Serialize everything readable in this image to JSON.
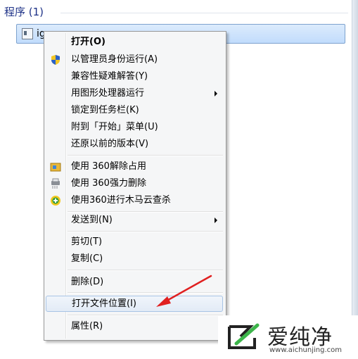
{
  "results": {
    "section_title": "程序 (1)",
    "selected_item_label": "ig"
  },
  "menu": {
    "items": [
      {
        "label": "打开(O)",
        "bold": true
      },
      {
        "label": "以管理员身份运行(A)",
        "icon": "uac-shield-icon"
      },
      {
        "label": "兼容性疑难解答(Y)"
      },
      {
        "label": "用图形处理器运行",
        "submenu": true
      },
      {
        "label": "锁定到任务栏(K)"
      },
      {
        "label": "附到「开始」菜单(U)"
      },
      {
        "label": "还原以前的版本(V)"
      },
      {
        "label": "使用 360解除占用",
        "icon": "360-unlock-icon"
      },
      {
        "label": "使用 360强力删除",
        "icon": "360-shred-icon"
      },
      {
        "label": "使用360进行木马云查杀",
        "icon": "360-scan-icon"
      },
      {
        "label": "发送到(N)",
        "submenu": true
      },
      {
        "label": "剪切(T)"
      },
      {
        "label": "复制(C)"
      },
      {
        "label": "删除(D)"
      },
      {
        "label": "打开文件位置(I)",
        "highlighted": true
      },
      {
        "label": "属性(R)"
      }
    ]
  },
  "annotation": {
    "arrow_color": "#e02020"
  },
  "watermark": {
    "brand": "爱纯净",
    "url": "www.aichunjing.com"
  }
}
